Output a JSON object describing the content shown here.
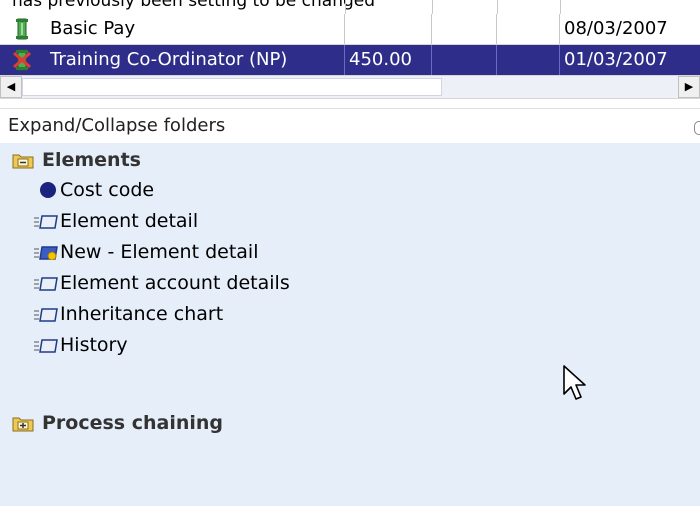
{
  "top_fragment": {
    "text": "has previously been setting to be changed"
  },
  "grid": {
    "rows": [
      {
        "name": "Basic Pay",
        "amount": "",
        "extra1": "",
        "extra2": "",
        "date": "08/03/2007",
        "selected": false,
        "icon": "pay-bar-icon"
      },
      {
        "name": "Training Co-Ordinator (NP)",
        "amount": "450.00",
        "extra1": "",
        "extra2": "",
        "date": "01/03/2007",
        "selected": true,
        "icon": "deleted-element-icon"
      }
    ]
  },
  "scrollbar": {
    "left_arrow": "◀",
    "right_arrow": "▶"
  },
  "toolbar": {
    "label": "Expand/Collapse folders"
  },
  "tree": {
    "folders": [
      {
        "label": "Elements",
        "state": "expanded",
        "icon": "folder-minus-icon",
        "items": [
          {
            "label": "Cost code",
            "icon": "blue-dot-icon"
          },
          {
            "label": "Element detail",
            "icon": "form-icon"
          },
          {
            "label": "New - Element detail",
            "icon": "new-form-icon"
          },
          {
            "label": "Element account details",
            "icon": "form-icon"
          },
          {
            "label": "Inheritance chart",
            "icon": "form-icon"
          },
          {
            "label": "History",
            "icon": "form-icon"
          }
        ]
      },
      {
        "label": "Process chaining",
        "state": "collapsed",
        "icon": "folder-plus-icon",
        "items": []
      }
    ]
  },
  "colors": {
    "selection": "#2e2e8a",
    "tree_background": "#e6eef9",
    "folder": "#e8c04a"
  }
}
